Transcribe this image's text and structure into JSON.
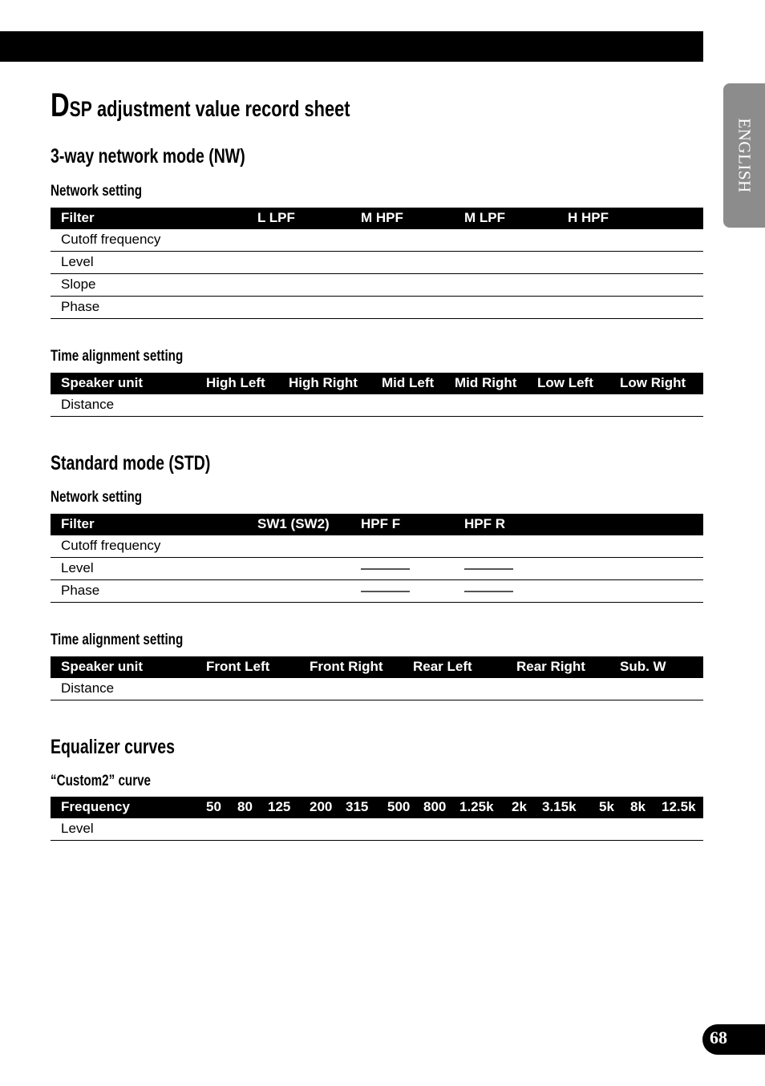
{
  "header": {
    "title_initial": "D",
    "title_sc": "SP",
    "title_rest": "adjustment value record sheet"
  },
  "side_tab": {
    "label": "ENGLISH"
  },
  "page_number": "68",
  "sections": {
    "nw": {
      "heading": "3-way network mode (NW)",
      "network": {
        "heading": "Network setting",
        "columns": [
          "Filter",
          "L LPF",
          "M HPF",
          "M LPF",
          "H HPF"
        ],
        "rows": [
          "Cutoff frequency",
          "Level",
          "Slope",
          "Phase"
        ]
      },
      "time": {
        "heading": "Time alignment setting",
        "columns": [
          "Speaker unit",
          "High Left",
          "High Right",
          "Mid Left",
          "Mid Right",
          "Low Left",
          "Low Right"
        ],
        "rows": [
          "Distance"
        ]
      }
    },
    "std": {
      "heading": "Standard mode (STD)",
      "network": {
        "heading": "Network setting",
        "columns": [
          "Filter",
          "SW1 (SW2)",
          "HPF F",
          "HPF R"
        ],
        "rows": [
          "Cutoff frequency",
          "Level",
          "Phase"
        ],
        "not_applicable_marker": "———"
      },
      "time": {
        "heading": "Time alignment setting",
        "columns": [
          "Speaker unit",
          "Front Left",
          "Front Right",
          "Rear Left",
          "Rear Right",
          "Sub. W"
        ],
        "rows": [
          "Distance"
        ]
      }
    },
    "eq": {
      "heading": "Equalizer curves",
      "curve": {
        "heading": "“Custom2” curve",
        "columns": [
          "Frequency",
          "50",
          "80",
          "125",
          "200",
          "315",
          "500",
          "800",
          "1.25k",
          "2k",
          "3.15k",
          "5k",
          "8k",
          "12.5k"
        ],
        "rows": [
          "Level"
        ]
      }
    }
  }
}
